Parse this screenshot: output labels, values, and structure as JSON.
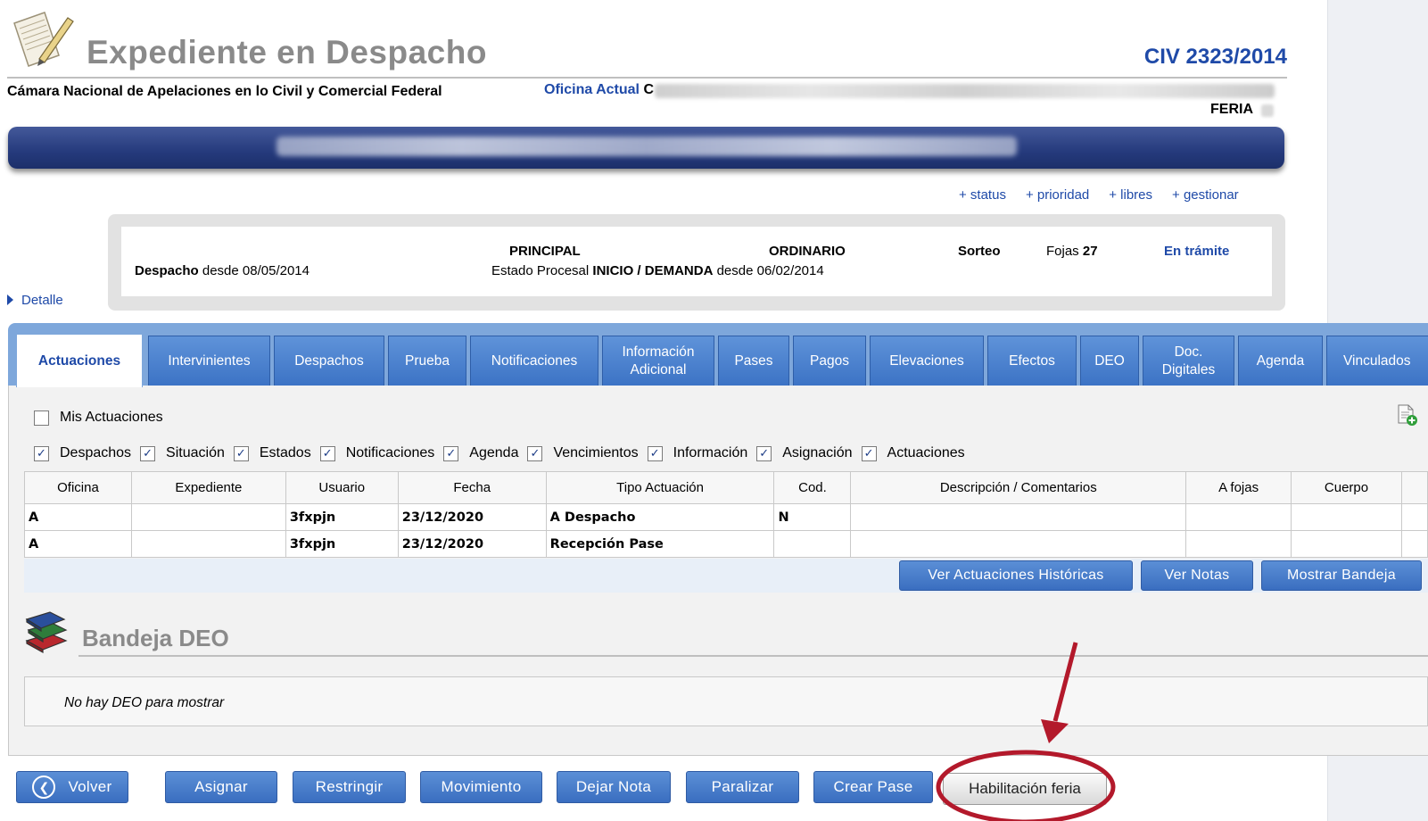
{
  "header": {
    "title": "Expediente en Despacho",
    "case_number": "CIV 2323/2014",
    "court": "Cámara Nacional de Apelaciones en lo Civil y Comercial Federal",
    "oficina_label": "Oficina Actual",
    "oficina_first_char": "C",
    "feria_label": "FERIA"
  },
  "action_links": [
    "+ status",
    "+ prioridad",
    "+ libres",
    "+ gestionar"
  ],
  "summary": {
    "despacho_label": "Despacho",
    "despacho_desde": "desde 08/05/2014",
    "principal": "PRINCIPAL",
    "estado_label": "Estado Procesal",
    "estado_value": "INICIO / DEMANDA",
    "estado_desde": "desde 06/02/2014",
    "ordinario": "ORDINARIO",
    "sorteo": "Sorteo",
    "fojas_label": "Fojas",
    "fojas_value": "27",
    "status": "En trámite"
  },
  "detalle": "Detalle",
  "tabs": [
    {
      "label": "Actuaciones"
    },
    {
      "label": "Intervinientes"
    },
    {
      "label": "Despachos"
    },
    {
      "label": "Prueba"
    },
    {
      "label": "Notificaciones"
    },
    {
      "label": "Información Adicional"
    },
    {
      "label": "Pases"
    },
    {
      "label": "Pagos"
    },
    {
      "label": "Elevaciones"
    },
    {
      "label": "Efectos"
    },
    {
      "label": "DEO"
    },
    {
      "label": "Doc. Digitales"
    },
    {
      "label": "Agenda"
    },
    {
      "label": "Vinculados"
    }
  ],
  "filters": {
    "mis_actuaciones": "Mis Actuaciones",
    "checks": [
      "Despachos",
      "Situación",
      "Estados",
      "Notificaciones",
      "Agenda",
      "Vencimientos",
      "Información",
      "Asignación",
      "Actuaciones"
    ]
  },
  "table": {
    "headers": [
      "Oficina",
      "Expediente",
      "Usuario",
      "Fecha",
      "Tipo Actuación",
      "Cod.",
      "Descripción / Comentarios",
      "A fojas",
      "Cuerpo",
      ""
    ],
    "rows": [
      [
        "A",
        "",
        "3fxpjn",
        "23/12/2020",
        "A Despacho",
        "N",
        "",
        "",
        "",
        ""
      ],
      [
        "A",
        "",
        "3fxpjn",
        "23/12/2020",
        "Recepción Pase",
        "",
        "",
        "",
        "",
        ""
      ]
    ]
  },
  "table_buttons": {
    "historicas": "Ver Actuaciones Históricas",
    "notas": "Ver Notas",
    "bandeja": "Mostrar Bandeja"
  },
  "bandeja": {
    "title": "Bandeja DEO",
    "empty": "No hay DEO para mostrar"
  },
  "bottom_buttons": {
    "volver": "Volver",
    "asignar": "Asignar",
    "restringir": "Restringir",
    "movimiento": "Movimiento",
    "dejar_nota": "Dejar Nota",
    "paralizar": "Paralizar",
    "crear_pase": "Crear Pase",
    "habilitacion_feria": "Habilitación feria"
  },
  "colors": {
    "accent_blue": "#1f4aa8",
    "button_blue": "#3a6ec0",
    "caratula_bar": "#253a7c",
    "annotation_red": "#b3192b"
  }
}
